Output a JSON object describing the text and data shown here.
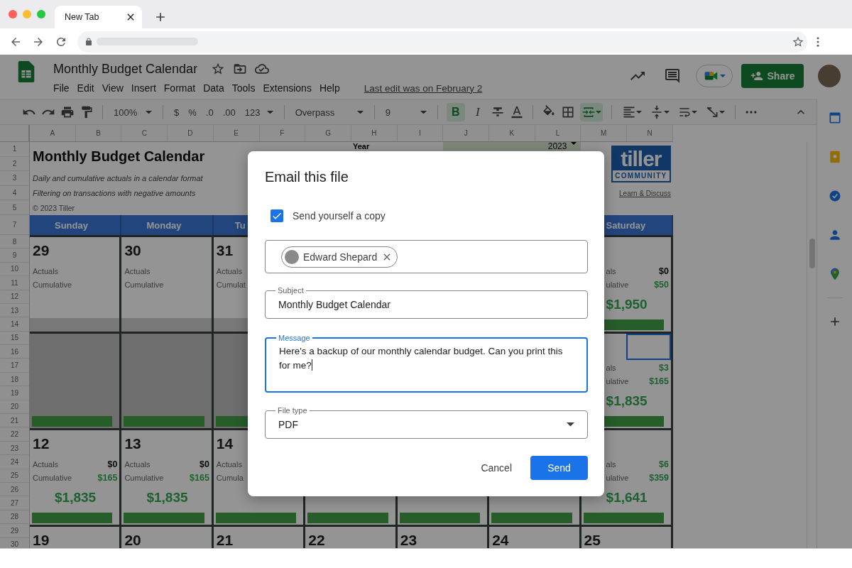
{
  "browser": {
    "tab": {
      "title": "New Tab"
    }
  },
  "app": {
    "title": "Monthly Budget Calendar",
    "menu": [
      "File",
      "Edit",
      "View",
      "Insert",
      "Format",
      "Data",
      "Tools",
      "Extensions",
      "Help"
    ],
    "last_edit": "Last edit was on February 2",
    "share": "Share"
  },
  "toolbar": {
    "zoom": "100%",
    "currency": "$",
    "percent": "%",
    "decrease_decimals": ".0",
    "increase_decimals": ".00",
    "number_format": "123",
    "font": "Overpass",
    "font_size": "9",
    "bold": {
      "label": "B",
      "on": true
    },
    "italic": {
      "label": "I",
      "on": false
    },
    "merge": {
      "on": true
    }
  },
  "sheet": {
    "columns": [
      "A",
      "B",
      "C",
      "D",
      "E",
      "F",
      "G",
      "H",
      "I",
      "J",
      "K",
      "L",
      "M",
      "N"
    ],
    "rows": [
      "1",
      "2",
      "3",
      "4",
      "5",
      "7",
      "8",
      "9",
      "10",
      "11",
      "12",
      "13",
      "14",
      "15",
      "16",
      "17",
      "18",
      "19",
      "20",
      "21",
      "22",
      "23",
      "24",
      "25",
      "26",
      "27",
      "28",
      "29",
      "30"
    ],
    "title": "Monthly Budget Calendar",
    "subtitles": [
      "Daily and cumulative actuals in a calendar format",
      "Filtering on transactions with negative amounts"
    ],
    "copyright": "© 2023 Tiller",
    "year_label": "Year",
    "year": "2023",
    "logo": {
      "word": "tiller",
      "tagline": "COMMUNITY"
    },
    "logo_link": "Learn & Discuss",
    "weekdays": [
      {
        "label": "Sunday"
      },
      {
        "label": "Monday"
      },
      {
        "label": "Tu"
      },
      {
        "label": "Saturday"
      }
    ],
    "weeks": [
      {
        "cells": [
          {
            "date": "29",
            "actuals_label": "Actuals",
            "cumulative_label": "Cumulative",
            "greyed": false,
            "bar": false,
            "selected": false
          },
          {
            "date": "30",
            "actuals_label": "Actuals",
            "cumulative_label": "Cumulative",
            "greyed": false,
            "bar": false,
            "selected": false
          },
          {
            "date": "31",
            "actuals_label": "Actuals",
            "cumulative_label": "Cumulat",
            "greyed": false,
            "bar": false,
            "selected": false
          },
          {},
          {},
          {},
          {
            "actuals_label": "als",
            "actuals": "$0",
            "actuals_positive": false,
            "cumulative_label": "ulative",
            "cumulative": "$50",
            "total": "$1,950",
            "greyed": false,
            "bar": true,
            "selected": false
          }
        ]
      },
      {
        "cells": [
          {
            "greyed": true,
            "bar": true,
            "selected": false
          },
          {
            "greyed": true,
            "bar": true,
            "selected": false
          },
          {
            "greyed": true,
            "bar": true,
            "selected": false
          },
          {},
          {},
          {},
          {
            "actuals_label": "als",
            "actuals": "$3",
            "actuals_positive": true,
            "cumulative_label": "ulative",
            "cumulative": "$165",
            "total": "$1,835",
            "greyed": false,
            "bar": true,
            "selected": true
          }
        ]
      },
      {
        "cells": [
          {
            "date": "12",
            "actuals_label": "Actuals",
            "actuals": "$0",
            "actuals_positive": false,
            "cumulative_label": "Cumulative",
            "cumulative": "$165",
            "total": "$1,835",
            "greyed": false,
            "bar": true,
            "selected": false
          },
          {
            "date": "13",
            "actuals_label": "Actuals",
            "actuals": "$0",
            "actuals_positive": false,
            "cumulative_label": "Cumulative",
            "cumulative": "$165",
            "total": "$1,835",
            "greyed": false,
            "bar": true,
            "selected": false
          },
          {
            "date": "14",
            "actuals_label": "Actuals",
            "cumulative_label": "Cumula",
            "greyed": false,
            "bar": true,
            "selected": false
          },
          {
            "bar": true
          },
          {
            "bar": true
          },
          {
            "bar": true
          },
          {
            "actuals_label": "als",
            "actuals": "$6",
            "actuals_positive": true,
            "cumulative_label": "ulative",
            "cumulative": "$359",
            "total": "$1,641",
            "greyed": false,
            "bar": true,
            "selected": false
          }
        ]
      },
      {
        "cells": [
          {
            "date": "19",
            "greyed": false,
            "selected": false
          },
          {
            "date": "20",
            "greyed": false,
            "selected": false
          },
          {
            "date": "21",
            "greyed": false,
            "selected": false
          },
          {
            "date": "22",
            "greyed": false,
            "selected": false
          },
          {
            "date": "23",
            "greyed": false,
            "selected": false
          },
          {
            "date": "24",
            "greyed": false,
            "selected": false
          },
          {
            "date": "25",
            "greyed": false,
            "selected": false
          }
        ]
      }
    ]
  },
  "dialog": {
    "title": "Email this file",
    "send_copy": {
      "label": "Send yourself a copy",
      "checked": true
    },
    "recipients": [
      {
        "name": "Edward Shepard"
      }
    ],
    "subject": {
      "label": "Subject",
      "value": "Monthly Budget Calendar",
      "focused": false
    },
    "message": {
      "label": "Message",
      "value": "Here's a backup of our monthly calendar budget. Can you print this for me?",
      "focused": true
    },
    "file_type": {
      "label": "File type",
      "value": "PDF"
    },
    "buttons": [
      {
        "label": "Cancel",
        "kind": "text"
      },
      {
        "label": "Send",
        "kind": "primary"
      }
    ]
  }
}
